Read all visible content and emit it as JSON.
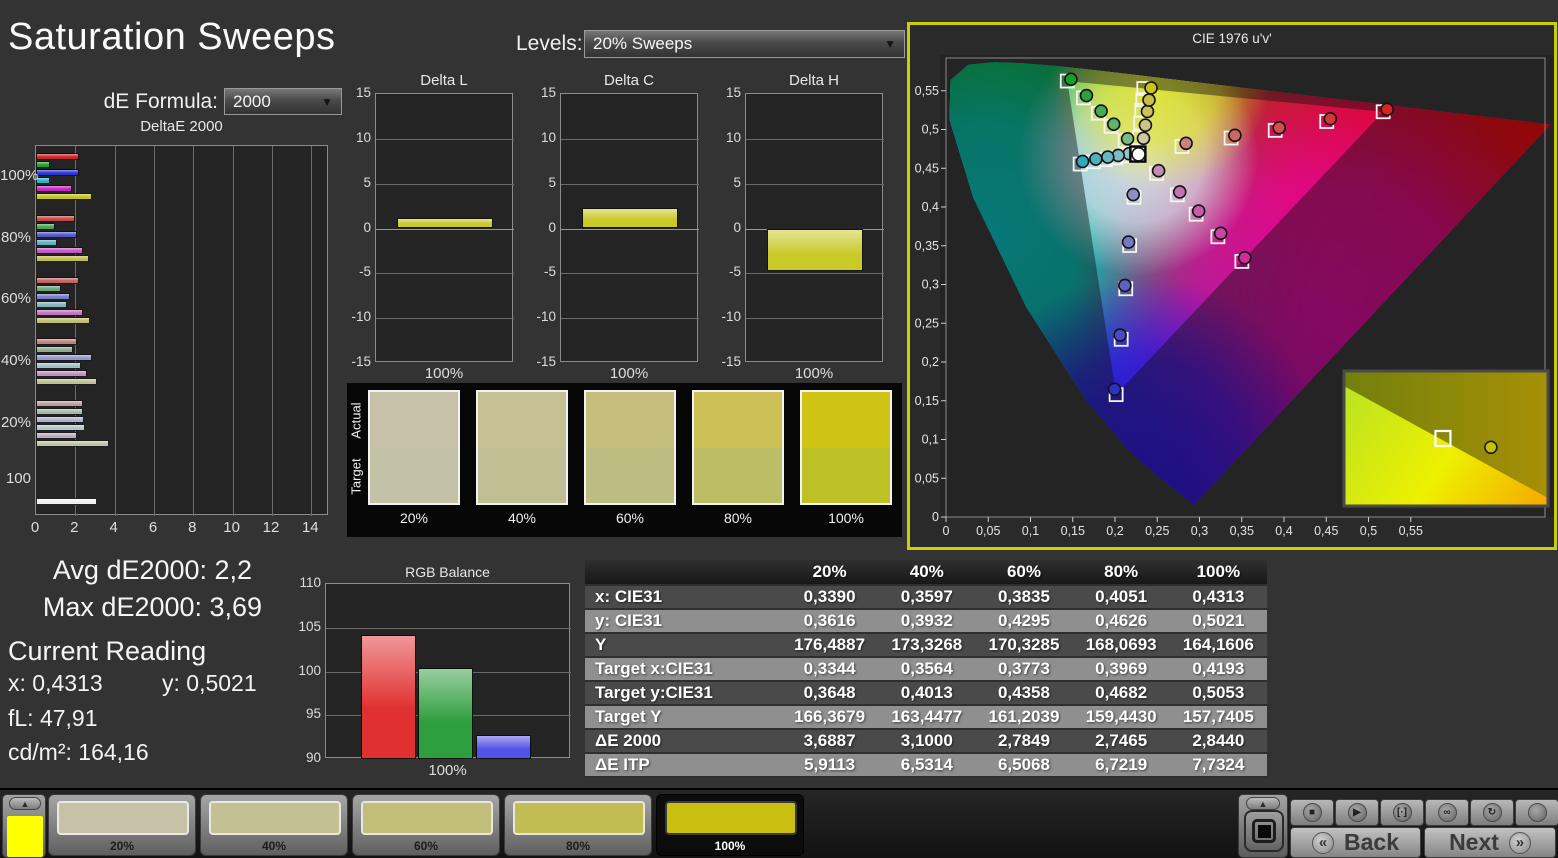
{
  "app": {
    "title": "Saturation Sweeps"
  },
  "controls": {
    "de_formula_label": "dE Formula:",
    "de_formula_value": "2000",
    "levels_label": "Levels:",
    "levels_value": "20% Sweeps",
    "chevron_down_glyph": "▼",
    "up_arrow_glyph": "▲"
  },
  "colors": {
    "page_bg": "#333333",
    "cie_highlight_border": "#c9ce05",
    "current_patch_color": "#ffff00"
  },
  "summary": {
    "avg": "Avg dE2000: 2,2",
    "max": "Max dE2000: 3,69",
    "current_reading_title": "Current Reading",
    "x": "x: 0,4313",
    "y": "y: 0,5021",
    "fl": "fL: 47,91",
    "cdm2": "cd/m²: 164,16"
  },
  "chart_data": [
    {
      "id": "deltae2000",
      "type": "bar",
      "orientation": "horizontal",
      "title": "DeltaE 2000",
      "xlim": [
        0,
        14.9
      ],
      "xticks": [
        0,
        2,
        4,
        6,
        8,
        10,
        12,
        14
      ],
      "groups": [
        {
          "label": "100%",
          "values": [
            2.2,
            0.7,
            2.2,
            0.7,
            1.85,
            2.85
          ],
          "colors": [
            "#cc2525",
            "#1ea12c",
            "#2a35d4",
            "#27b4c2",
            "#c623c6",
            "#c3c31d"
          ]
        },
        {
          "label": "80%",
          "values": [
            2.0,
            0.95,
            2.1,
            1.05,
            2.4,
            2.7
          ],
          "colors": [
            "#c64848",
            "#47a351",
            "#5058cc",
            "#58b0ba",
            "#c356c3",
            "#bebe4a"
          ]
        },
        {
          "label": "60%",
          "values": [
            2.2,
            1.25,
            1.75,
            1.6,
            2.4,
            2.75
          ],
          "colors": [
            "#c26262",
            "#69a671",
            "#757bc8",
            "#82b5bc",
            "#c172c1",
            "#bebe6d"
          ]
        },
        {
          "label": "40%",
          "values": [
            2.1,
            1.9,
            2.85,
            2.3,
            2.6,
            3.1
          ],
          "colors": [
            "#bf8080",
            "#8cac91",
            "#9297ca",
            "#a2bfc2",
            "#c08fc0",
            "#bfbf8f"
          ]
        },
        {
          "label": "20%",
          "values": [
            2.4,
            2.4,
            2.45,
            2.5,
            2.1,
            3.69
          ],
          "colors": [
            "#bb9f9f",
            "#a6b8a9",
            "#adb0cf",
            "#b4c5c7",
            "#bfa9bf",
            "#c1c1a8"
          ]
        },
        {
          "label": "100",
          "values": [
            3.1
          ],
          "colors": [
            "#f0f0f0"
          ]
        }
      ]
    },
    {
      "id": "delta_l",
      "type": "bar",
      "title": "Delta L",
      "categories": [
        "100%"
      ],
      "values": [
        1.2
      ],
      "ylim": [
        -15,
        15
      ],
      "yticks": [
        15,
        10,
        5,
        0,
        -5,
        -10,
        -15
      ],
      "bar_color": "#c9c92a"
    },
    {
      "id": "delta_c",
      "type": "bar",
      "title": "Delta C",
      "categories": [
        "100%"
      ],
      "values": [
        2.3
      ],
      "ylim": [
        -15,
        15
      ],
      "yticks": [
        15,
        10,
        5,
        0,
        -5,
        -10,
        -15
      ],
      "bar_color": "#c9c92a"
    },
    {
      "id": "delta_h",
      "type": "bar",
      "title": "Delta H",
      "categories": [
        "100%"
      ],
      "values": [
        -4.7
      ],
      "ylim": [
        -15,
        15
      ],
      "yticks": [
        15,
        10,
        5,
        0,
        -5,
        -10,
        -15
      ],
      "bar_color": "#c9c92a"
    },
    {
      "id": "rgb_balance",
      "type": "bar",
      "title": "RGB Balance",
      "categories": [
        "100%"
      ],
      "series": [
        {
          "name": "red",
          "value": 104.2,
          "color": "#e03030"
        },
        {
          "name": "green",
          "value": 100.4,
          "color": "#2f9e3f"
        },
        {
          "name": "blue",
          "value": 92.7,
          "color": "#5353e8"
        }
      ],
      "ylim": [
        90,
        110
      ],
      "yticks": [
        110,
        105,
        100,
        95,
        90
      ]
    },
    {
      "id": "cie",
      "type": "scatter",
      "title": "CIE 1976 u'v'",
      "xticks": [
        0,
        0.05,
        0.1,
        0.15,
        0.2,
        0.25,
        0.3,
        0.35,
        0.4,
        0.45,
        0.5,
        0.55
      ],
      "yticks": [
        0,
        0.05,
        0.1,
        0.15,
        0.2,
        0.25,
        0.3,
        0.35,
        0.4,
        0.45,
        0.5,
        0.55
      ],
      "gamut_triangle": {
        "red": [
          0.4507,
          0.5229
        ],
        "green": [
          0.125,
          0.5625
        ],
        "blue": [
          0.1754,
          0.1579
        ]
      },
      "white_point": {
        "target": [
          0.1978,
          0.4683
        ],
        "measured": [
          0.1985,
          0.468
        ]
      },
      "sweeps": [
        {
          "name": "red",
          "targets": [
            [
              0.2433,
              0.4781
            ],
            [
              0.2939,
              0.489
            ],
            [
              0.3394,
              0.4989
            ],
            [
              0.3925,
              0.5103
            ],
            [
              0.4507,
              0.5229
            ]
          ],
          "measured": [
            [
              0.2475,
              0.4822
            ],
            [
              0.2978,
              0.4925
            ],
            [
              0.3435,
              0.5022
            ],
            [
              0.3962,
              0.5138
            ],
            [
              0.4548,
              0.526
            ]
          ],
          "fills": [
            "#c98181",
            "#cd6767",
            "#d04f4f",
            "#d43838",
            "#d82424"
          ]
        },
        {
          "name": "green",
          "targets": [
            [
              0.1847,
              0.4853
            ],
            [
              0.1701,
              0.5041
            ],
            [
              0.157,
              0.521
            ],
            [
              0.1417,
              0.5408
            ],
            [
              0.125,
              0.5625
            ]
          ],
          "measured": [
            [
              0.1872,
              0.488
            ],
            [
              0.1729,
              0.5068
            ],
            [
              0.1599,
              0.5238
            ],
            [
              0.1448,
              0.5438
            ],
            [
              0.1288,
              0.5648
            ]
          ],
          "fills": [
            "#7cba83",
            "#60b26a",
            "#47ab53",
            "#2ea23c",
            "#17a028"
          ]
        },
        {
          "name": "blue",
          "targets": [
            [
              0.1938,
              0.4124
            ],
            [
              0.1893,
              0.3503
            ],
            [
              0.1853,
              0.2945
            ],
            [
              0.1806,
              0.2293
            ],
            [
              0.1754,
              0.1579
            ]
          ],
          "measured": [
            [
              0.193,
              0.416
            ],
            [
              0.1882,
              0.3548
            ],
            [
              0.1844,
              0.2988
            ],
            [
              0.1795,
              0.2348
            ],
            [
              0.1738,
              0.1648
            ]
          ],
          "fills": [
            "#8d90c2",
            "#7579c2",
            "#5d61c2",
            "#474bc6",
            "#2e30ca"
          ]
        },
        {
          "name": "cyan",
          "targets": [
            [
              0.1871,
              0.466
            ],
            [
              0.1752,
              0.4634
            ],
            [
              0.1645,
              0.4611
            ],
            [
              0.152,
              0.4584
            ],
            [
              0.1383,
              0.4554
            ]
          ],
          "measured": [
            [
              0.1888,
              0.4688
            ],
            [
              0.1775,
              0.4665
            ],
            [
              0.1668,
              0.4645
            ],
            [
              0.1545,
              0.4618
            ],
            [
              0.1408,
              0.4588
            ]
          ],
          "fills": [
            "#93c3c9",
            "#7cbec6",
            "#64b8c1",
            "#49b2be",
            "#2fabba"
          ]
        },
        {
          "name": "magenta",
          "targets": [
            [
              0.2171,
              0.4434
            ],
            [
              0.2385,
              0.4157
            ],
            [
              0.2578,
              0.3907
            ],
            [
              0.2803,
              0.3616
            ],
            [
              0.305,
              0.3298
            ]
          ],
          "measured": [
            [
              0.2192,
              0.4468
            ],
            [
              0.241,
              0.4195
            ],
            [
              0.2605,
              0.3948
            ],
            [
              0.2832,
              0.366
            ],
            [
              0.308,
              0.3345
            ]
          ],
          "fills": [
            "#c18cb5",
            "#c375b0",
            "#c85eaa",
            "#cc45a2",
            "#d12c9a"
          ]
        },
        {
          "name": "yellow",
          "targets": [
            [
              0.1994,
              0.4894
            ],
            [
              0.2007,
              0.5085
            ],
            [
              0.2019,
              0.5247
            ],
            [
              0.2029,
              0.5385
            ],
            [
              0.2039,
              0.5529
            ]
          ],
          "measured": [
            [
              0.2036,
              0.4886
            ],
            [
              0.2056,
              0.5056
            ],
            [
              0.2077,
              0.5233
            ],
            [
              0.2093,
              0.538
            ],
            [
              0.2114,
              0.5536
            ]
          ],
          "fills": [
            "#cfc9a2",
            "#ccc37f",
            "#cac060",
            "#c9bf40",
            "#c9c514"
          ]
        }
      ],
      "inset": {
        "target_frac": [
          0.485,
          0.5
        ],
        "measured_frac": [
          0.72,
          0.565
        ]
      }
    }
  ],
  "swatch_strip": {
    "row_labels": [
      "Actual",
      "Target"
    ],
    "columns": [
      {
        "label": "20%",
        "actual": "#c8c1aa",
        "target": "#c3c1a6"
      },
      {
        "label": "40%",
        "actual": "#c6c195",
        "target": "#c0bf94"
      },
      {
        "label": "60%",
        "actual": "#c6be7c",
        "target": "#bdbd81"
      },
      {
        "label": "80%",
        "actual": "#ccbf55",
        "target": "#bcbd64"
      },
      {
        "label": "100%",
        "actual": "#cfc413",
        "target": "#bdc125"
      }
    ]
  },
  "table": {
    "headers": [
      "",
      "20%",
      "40%",
      "60%",
      "80%",
      "100%"
    ],
    "rows": [
      {
        "label": "x: CIE31",
        "values": [
          "0,3390",
          "0,3597",
          "0,3835",
          "0,4051",
          "0,4313"
        ]
      },
      {
        "label": "y: CIE31",
        "values": [
          "0,3616",
          "0,3932",
          "0,4295",
          "0,4626",
          "0,5021"
        ]
      },
      {
        "label": "Y",
        "values": [
          "176,4887",
          "173,3268",
          "170,3285",
          "168,0693",
          "164,1606"
        ]
      },
      {
        "label": "Target x:CIE31",
        "values": [
          "0,3344",
          "0,3564",
          "0,3773",
          "0,3969",
          "0,4193"
        ]
      },
      {
        "label": "Target y:CIE31",
        "values": [
          "0,3648",
          "0,4013",
          "0,4358",
          "0,4682",
          "0,5053"
        ]
      },
      {
        "label": "Target Y",
        "values": [
          "166,3679",
          "163,4477",
          "161,2039",
          "159,4430",
          "157,7405"
        ]
      },
      {
        "label": "ΔE 2000",
        "values": [
          "3,6887",
          "3,1000",
          "2,7849",
          "2,7465",
          "2,8440"
        ]
      },
      {
        "label": "ΔE ITP",
        "values": [
          "5,9113",
          "6,5314",
          "6,5068",
          "6,7219",
          "7,7324"
        ]
      }
    ]
  },
  "bottom_bar": {
    "current_color": "#ffff00",
    "tiles": [
      {
        "label": "20%",
        "color": "#c5c2a8",
        "selected": false
      },
      {
        "label": "40%",
        "color": "#c3c094",
        "selected": false
      },
      {
        "label": "60%",
        "color": "#c2bd79",
        "selected": false
      },
      {
        "label": "80%",
        "color": "#c1bc53",
        "selected": false
      },
      {
        "label": "100%",
        "color": "#c8bf10",
        "selected": true
      }
    ]
  },
  "transport": {
    "media_buttons": [
      {
        "name": "stop",
        "glyph": "■"
      },
      {
        "name": "play",
        "glyph": "▶"
      },
      {
        "name": "step",
        "glyph": "[·]"
      },
      {
        "name": "loop",
        "glyph": "∞"
      },
      {
        "name": "refresh",
        "glyph": "↻"
      },
      {
        "name": "blank",
        "glyph": ""
      }
    ],
    "back_label": "Back",
    "next_label": "Next",
    "back_chevron": "«",
    "next_chevron": "»"
  }
}
